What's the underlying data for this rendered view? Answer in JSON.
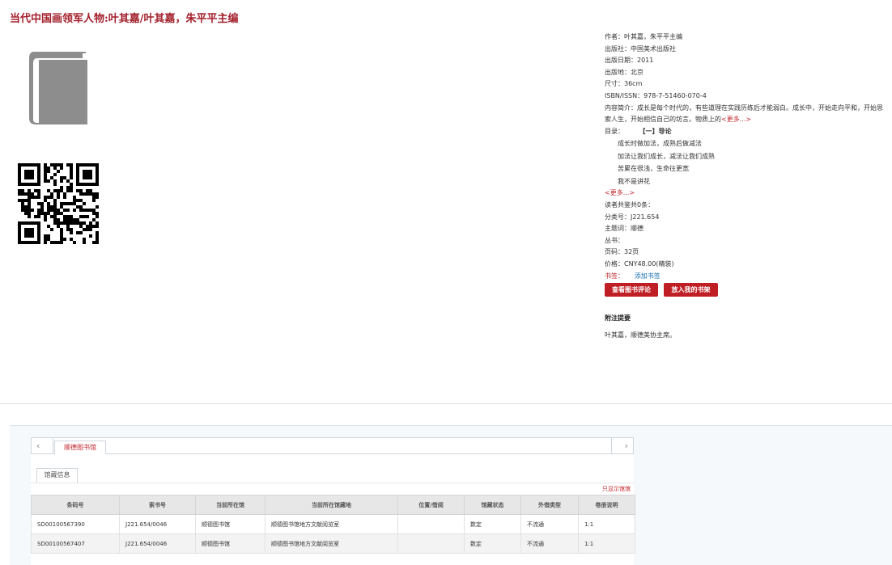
{
  "book": {
    "title": "当代中国画领军人物:叶其嘉/叶其嘉，朱平平主编"
  },
  "details": {
    "author": "作者：叶其嘉，朱平平主编",
    "publisher": "出版社：中国美术出版社",
    "pub_date": "出版日期：2011",
    "pub_place": "出版地：北京",
    "size": "尺寸：36cm",
    "isbn": "ISBN/ISSN：978-7-51460-070-4",
    "summary": "内容简介：成长是每个时代的，有些道理在实践历练后才能弱白。成长中，开始走向平和，开始思索人生，开始相信自己的坊言。物质上的",
    "summary_more": "<更多...>",
    "toc_label": "目录：",
    "toc_first": "【一】导论",
    "toc_items": [
      "成长时做加法，成熟后做减法",
      "加法让我们成长，减法让我们成熟",
      "苦累在很浅，生命往更宽",
      "我不是讲花"
    ],
    "toc_more": "<更多...>",
    "comments": "读者共鉴共0条：",
    "class_no": "分类号：J221.654",
    "subject": "主题词：顺德",
    "series": "丛书：",
    "pages": "页码：32页",
    "price": "价格：CNY48.00(精装)",
    "tags_label": "书签：",
    "tags_add": "添加书签"
  },
  "actions": {
    "review_button": "查看图书评论",
    "shelf_button": "放入我的书架"
  },
  "notes": {
    "heading": "附注提要",
    "text": "叶其嘉，顺德美协主席。"
  },
  "holdings": {
    "library_tab": "顺德图书馆",
    "info_tab": "馆藏信息",
    "only_lib": "只显示馆馆",
    "columns": [
      "条码号",
      "索书号",
      "当前所在馆",
      "当前所在馆藏地",
      "位置/借阅",
      "馆藏状态",
      "外借类型",
      "卷册说明"
    ],
    "rows": [
      [
        "SD00100567390",
        "J221.654/0046",
        "顺德图书馆",
        "顺德图书馆地方文献阅览室",
        "",
        "数定",
        "不流通",
        "1:1"
      ],
      [
        "SD00100567407",
        "J221.654/0046",
        "顺德图书馆",
        "顺德图书馆地方文献阅览室",
        "",
        "数定",
        "不流通",
        "1:1"
      ]
    ]
  },
  "icons": {
    "cover": "book-icon",
    "qr": "qr-code-icon",
    "prev": "chevron-left-icon",
    "next": "chevron-right-icon"
  },
  "colors": {
    "accent": "#bf1e24",
    "title": "#a31f2b",
    "icon": "#8d8d8d"
  }
}
